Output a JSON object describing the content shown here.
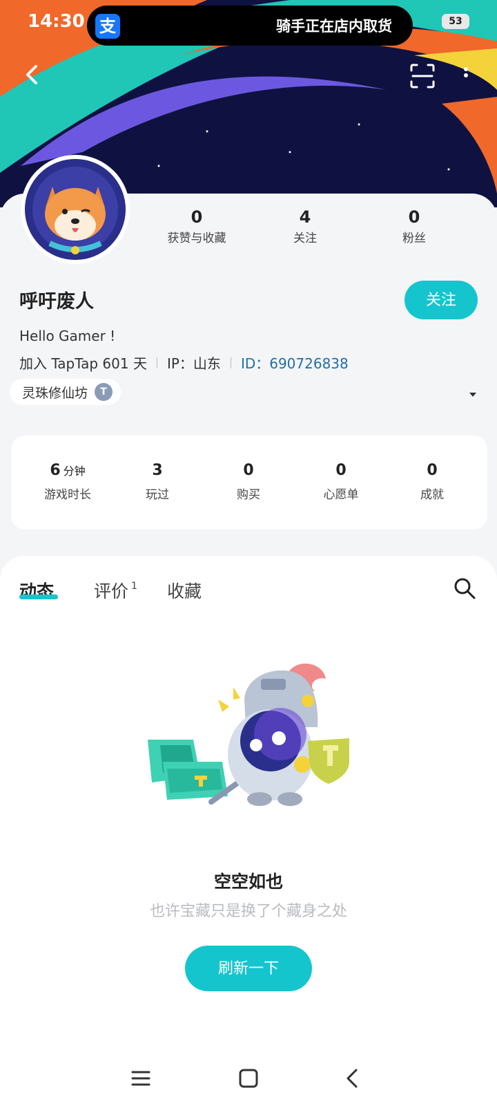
{
  "status_bar": {
    "time": "14:30",
    "app_icon": "alipay-icon",
    "app_glyph": "支",
    "live_activity": "骑手正在店内取货",
    "battery": "53"
  },
  "profile": {
    "name": "呼吁废人",
    "follow_button": "关注",
    "bio": "Hello Gamer !",
    "joined": "加入 TapTap 601 天",
    "ip": "IP：山东",
    "id": "ID：690726838",
    "guild_name": "灵珠修仙坊",
    "guild_badge": "T",
    "stats": [
      {
        "value": "0",
        "label": "获赞与收藏"
      },
      {
        "value": "4",
        "label": "关注"
      },
      {
        "value": "0",
        "label": "粉丝"
      }
    ]
  },
  "game_stats": [
    {
      "value": "6",
      "unit": "分钟",
      "label": "游戏时长"
    },
    {
      "value": "3",
      "unit": "",
      "label": "玩过"
    },
    {
      "value": "0",
      "unit": "",
      "label": "购买"
    },
    {
      "value": "0",
      "unit": "",
      "label": "心愿单"
    },
    {
      "value": "0",
      "unit": "",
      "label": "成就"
    }
  ],
  "tabs": [
    {
      "label": "动态",
      "badge": ""
    },
    {
      "label": "评价",
      "badge": "1"
    },
    {
      "label": "收藏",
      "badge": ""
    }
  ],
  "empty_state": {
    "title": "空空如也",
    "subtitle": "也许宝藏只是换了个藏身之处",
    "button": "刷新一下"
  },
  "colors": {
    "accent": "#15c5ce",
    "banner": "#0f1240",
    "id_link": "#1f6fa8"
  }
}
